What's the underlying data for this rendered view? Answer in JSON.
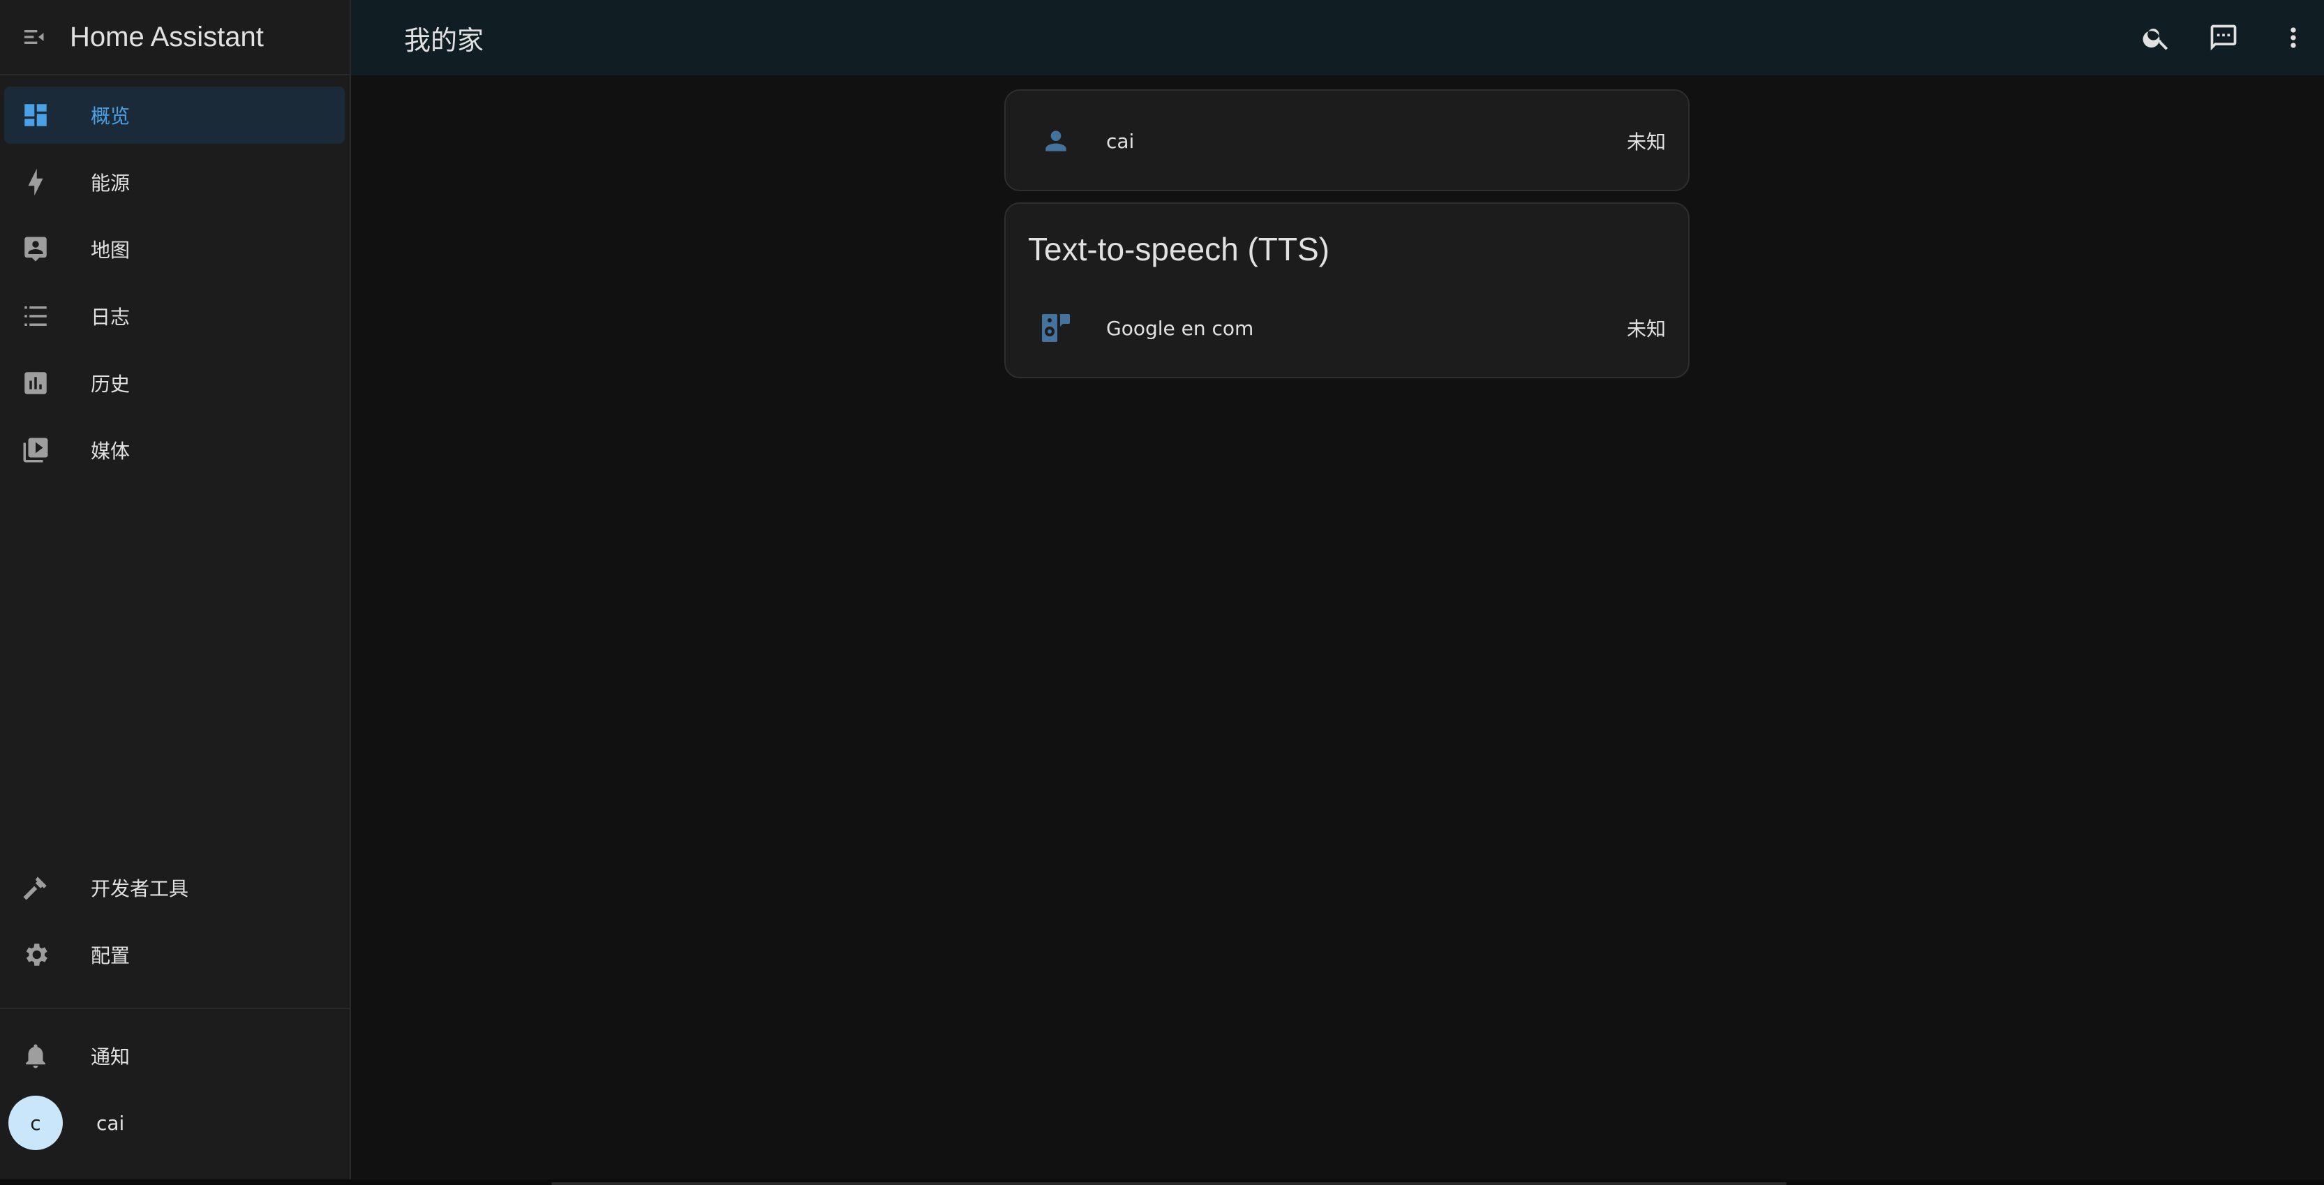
{
  "app": {
    "title": "Home Assistant"
  },
  "sidebar": {
    "items": [
      {
        "label": "概览",
        "icon": "dashboard-icon"
      },
      {
        "label": "能源",
        "icon": "lightning-bolt-icon"
      },
      {
        "label": "地图",
        "icon": "map-person-icon"
      },
      {
        "label": "日志",
        "icon": "list-icon"
      },
      {
        "label": "历史",
        "icon": "chart-box-icon"
      },
      {
        "label": "媒体",
        "icon": "media-play-icon"
      }
    ],
    "bottom_items": [
      {
        "label": "开发者工具",
        "icon": "hammer-icon"
      },
      {
        "label": "配置",
        "icon": "gear-icon"
      }
    ],
    "notifications_label": "通知",
    "user": {
      "initial": "c",
      "name": "cai"
    }
  },
  "header": {
    "title": "我的家"
  },
  "cards": {
    "person": {
      "name": "cai",
      "state": "未知"
    },
    "tts": {
      "title": "Text-to-speech (TTS)",
      "entity_name": "Google en com",
      "state": "未知"
    }
  },
  "colors": {
    "accent": "#4ba1e6",
    "entity_icon": "#44739e",
    "background": "#111111",
    "sidebar": "#1c1c1c",
    "topbar": "#101e24"
  }
}
